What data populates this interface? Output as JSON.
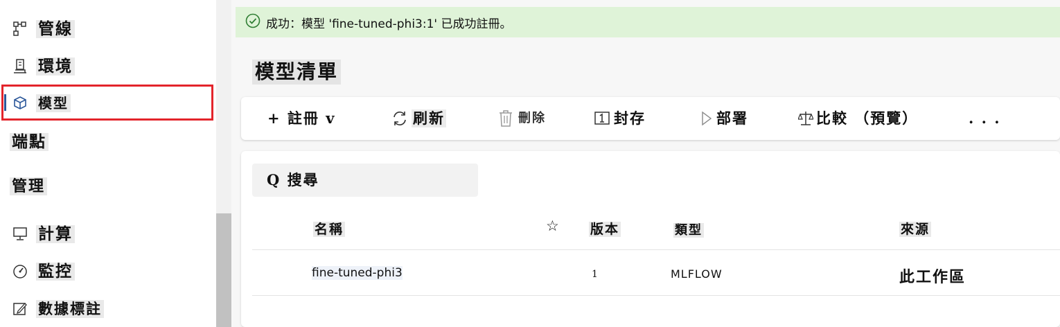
{
  "sidebar": {
    "items": [
      {
        "label": "管線",
        "icon": "pipeline-icon"
      },
      {
        "label": "環境",
        "icon": "environment-icon"
      },
      {
        "label": "模型",
        "icon": "cube-icon",
        "selected": true
      },
      {
        "label": "端點",
        "icon": "endpoint-icon"
      }
    ],
    "manage_section": "管理",
    "manage_items": [
      {
        "label": "計算",
        "icon": "compute-icon"
      },
      {
        "label": "監控",
        "icon": "gauge-icon"
      },
      {
        "label": "數據標註",
        "icon": "labeling-icon"
      }
    ]
  },
  "banner": {
    "text": "成功：模型 'fine-tuned-phi3:1' 已成功註冊。",
    "icon": "check-circle-icon",
    "color": "#dff3d8"
  },
  "page": {
    "title": "模型清單"
  },
  "toolbar": {
    "register": "+ 註冊 v",
    "refresh": "刷新",
    "delete": "刪除",
    "archive": "封存",
    "deploy": "部署",
    "compare": "比較 （預覽）",
    "more": ". . ."
  },
  "search": {
    "label": "Q 搜尋"
  },
  "table": {
    "columns": {
      "name": "名稱",
      "favorite": "☆",
      "version": "版本",
      "type": "類型",
      "source": "來源"
    },
    "rows": [
      {
        "name": "fine-tuned-phi3",
        "version": "1",
        "type": "MLFLOW",
        "source": "此工作區"
      }
    ]
  },
  "colors": {
    "selection_border": "#e3242b",
    "success_bg": "#dff3d8",
    "accent": "#2b579a"
  }
}
